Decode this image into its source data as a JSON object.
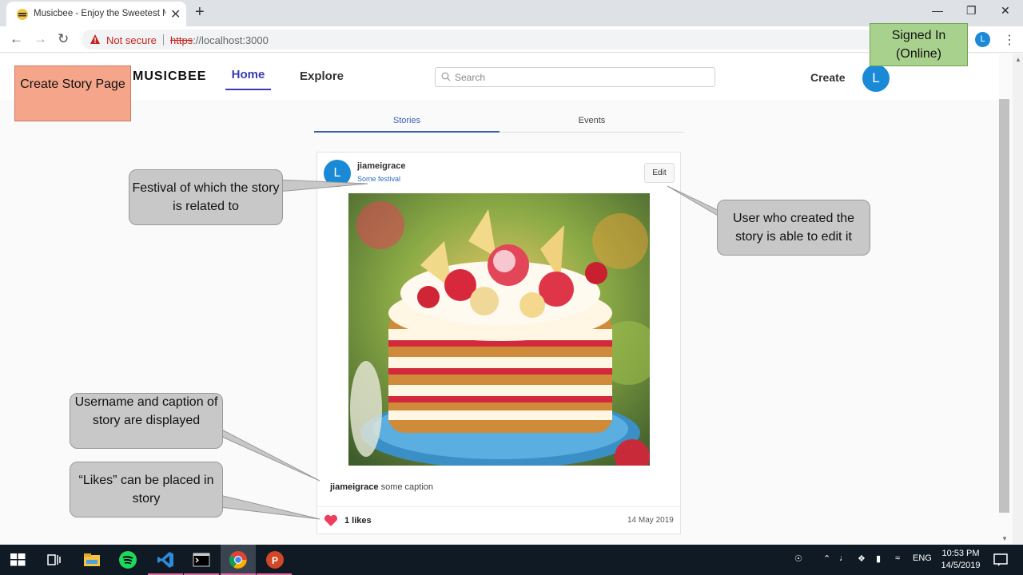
{
  "browser": {
    "tab_title": "Musicbee - Enjoy the Sweetest M",
    "tab_close": "✕",
    "new_tab": "+",
    "not_secure": "Not secure",
    "url_scheme": "https",
    "url_rest": "://localhost:3000",
    "profile_initial": "L"
  },
  "site": {
    "logo": "MUSICBEE",
    "nav_home": "Home",
    "nav_explore": "Explore",
    "search_placeholder": "Search",
    "create_label": "Create",
    "user_initial": "L"
  },
  "tabs": {
    "stories": "Stories",
    "events": "Events"
  },
  "story": {
    "avatar_initial": "L",
    "username": "jiameigrace",
    "festival": "Some festival",
    "edit_label": "Edit",
    "caption_user": "jiameigrace",
    "caption_text": " some caption",
    "likes": "1 likes",
    "date": "14 May 2019"
  },
  "annotations": {
    "page_title": "Create Story Page",
    "signed_in": "Signed In (Online)",
    "festival_note": "Festival of which the story is related to",
    "edit_note": "User who created the story is able to edit it",
    "caption_note": "Username and caption of story are displayed",
    "likes_note": "“Likes” can be placed in story"
  },
  "taskbar": {
    "lang": "ENG",
    "time": "10:53 PM",
    "date": "14/5/2019"
  },
  "colors": {
    "accent": "#3b3bb3",
    "avatar": "#1a8ad6",
    "heart": "#ee3e5e"
  }
}
